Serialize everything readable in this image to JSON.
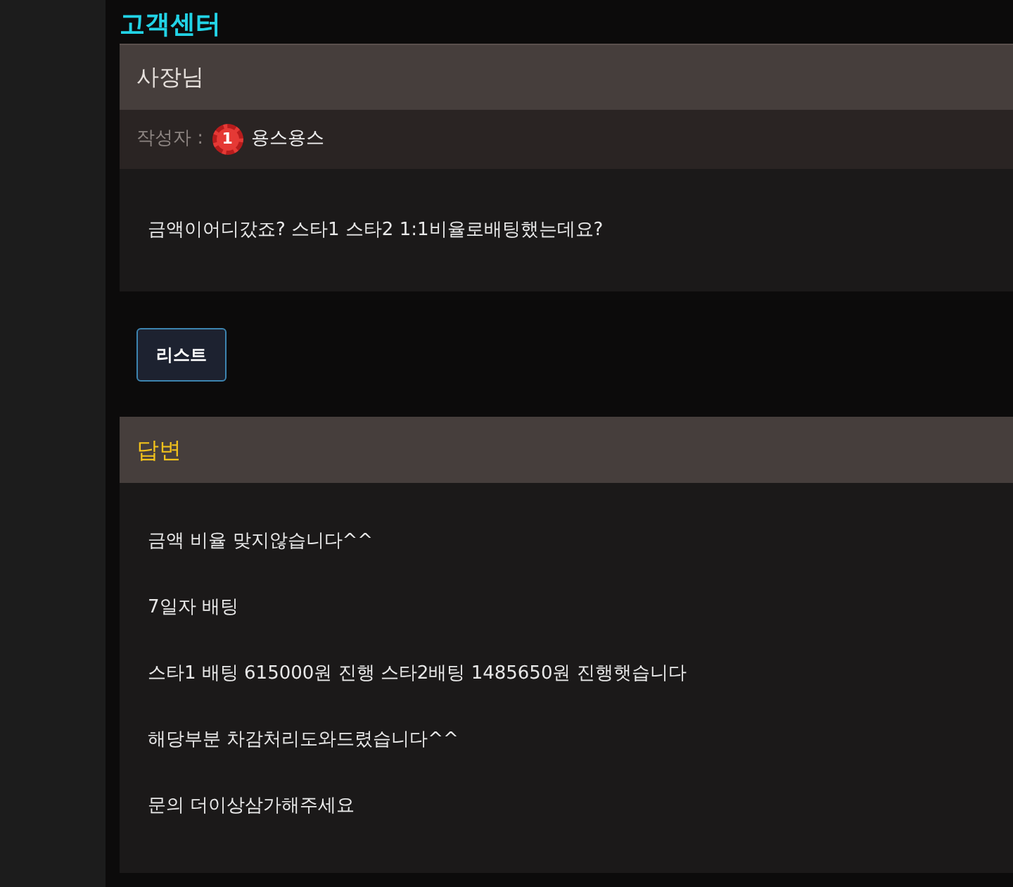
{
  "page_title": "고객센터",
  "post": {
    "title": "사장님",
    "author_label": "작성자 :",
    "author_level": "1",
    "author": "용스용스",
    "body": "금액이어디갔죠? 스타1 스타2 1:1비율로배팅했는데요?"
  },
  "list_button": "리스트",
  "answer": {
    "title": "답변",
    "lines": [
      "금액 비율 맞지않습니다^^",
      "7일자 배팅",
      "스타1 배팅 615000원 진행 스타2배팅 1485650원 진행햇습니다",
      "해당부분 차감처리도와드렸습니다^^",
      "문의 더이상삼가해주세요"
    ]
  }
}
